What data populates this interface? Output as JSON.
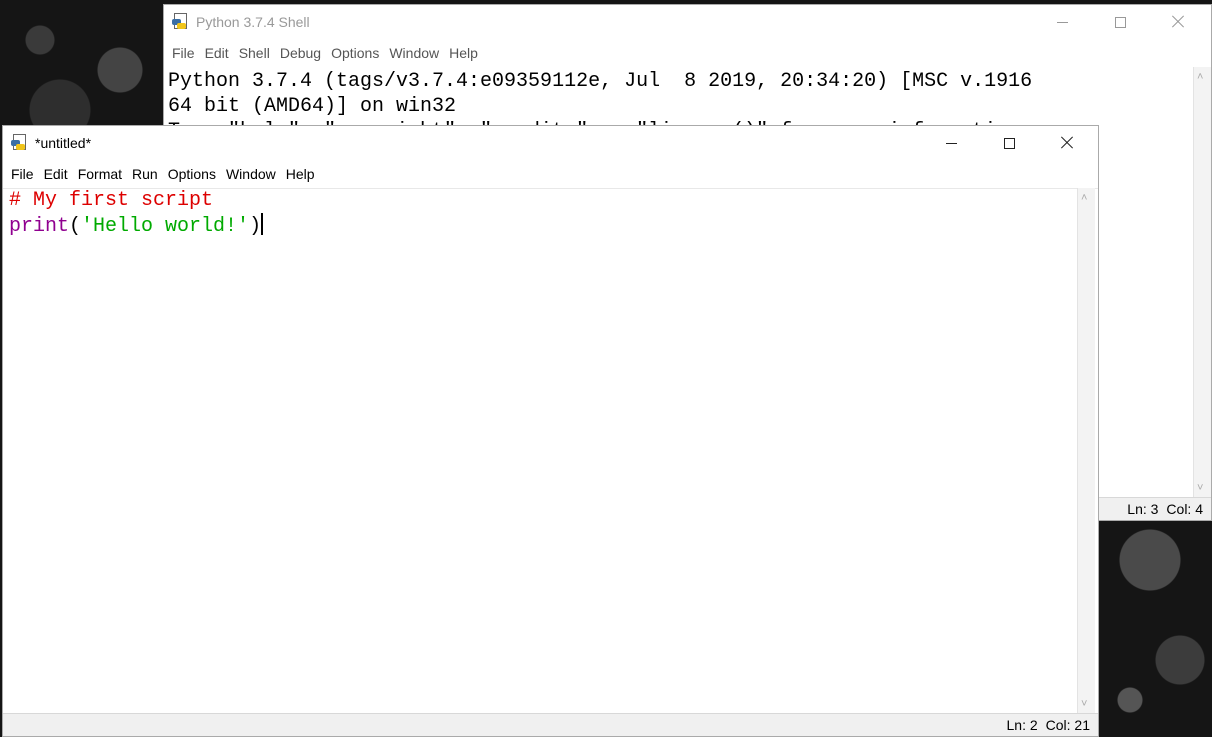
{
  "shell": {
    "title": "Python 3.7.4 Shell",
    "menu": [
      "File",
      "Edit",
      "Shell",
      "Debug",
      "Options",
      "Window",
      "Help"
    ],
    "lines": [
      "Python 3.7.4 (tags/v3.7.4:e09359112e, Jul  8 2019, 20:34:20) [MSC v.1916",
      "64 bit (AMD64)] on win32",
      "Type \"help\", \"copyright\", \"credits\" or \"license()\" for more information."
    ],
    "status_ln": "Ln: 3",
    "status_col": "Col: 4"
  },
  "editor": {
    "title": "*untitled*",
    "menu": [
      "File",
      "Edit",
      "Format",
      "Run",
      "Options",
      "Window",
      "Help"
    ],
    "comment_line": "# My first script",
    "code_keyword": "print",
    "code_open": "(",
    "code_string": "'Hello world!'",
    "code_close": ")",
    "status_ln": "Ln: 2",
    "status_col": "Col: 21"
  },
  "colors": {
    "comment": "#dd0000",
    "keyword": "#900090",
    "string": "#00aa00"
  }
}
